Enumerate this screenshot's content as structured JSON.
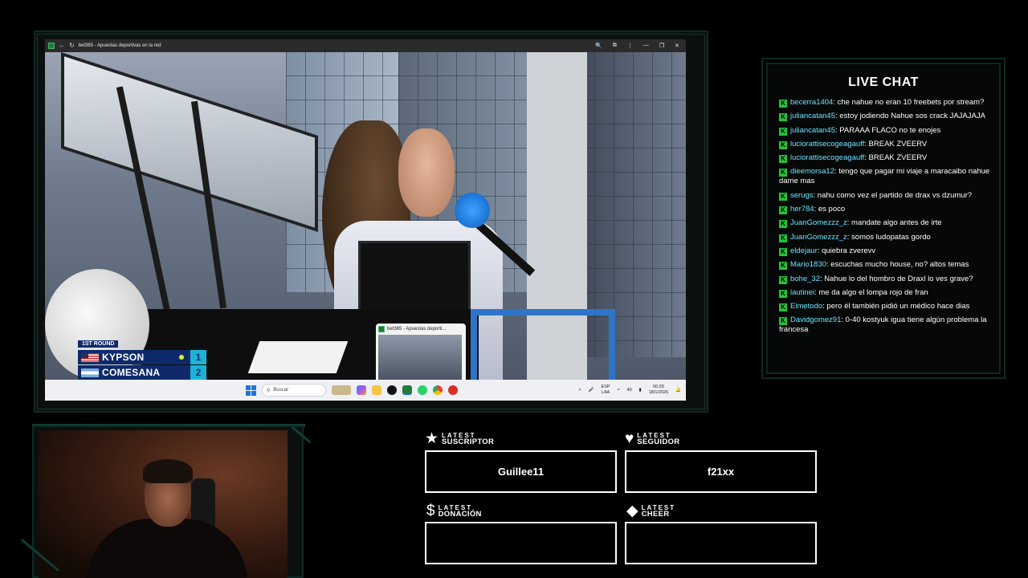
{
  "browser": {
    "tab_title": "bet365 - Apuestas deportivas en la red"
  },
  "scoreboard": {
    "round": "1ST ROUND",
    "players": [
      {
        "name": "KYPSON",
        "score": "1",
        "flag": "US",
        "serving": true
      },
      {
        "name": "COMESANA",
        "score": "2",
        "flag": "AR",
        "serving": false
      }
    ]
  },
  "thumbnail": {
    "title": "bet365 - Apuestas deporti..."
  },
  "taskbar": {
    "search_placeholder": "Buscar",
    "lang_top": "ESP",
    "lang_bottom": "LAA",
    "volume": "40",
    "time": "00:29",
    "date": "18/1/2026"
  },
  "chat": {
    "title": "LIVE CHAT",
    "messages": [
      {
        "user": "becerra1404",
        "text": "che nahue no eran 10 freebets por stream?"
      },
      {
        "user": "juliancatan45",
        "text": "estoy jodiendo Nahue sos crack JAJAJAJA"
      },
      {
        "user": "juliancatan45",
        "text": "PARAAA FLACO no te enojes"
      },
      {
        "user": "luciorattisecogeagauff",
        "text": "BREAK ZVEERV"
      },
      {
        "user": "luciorattisecogeagauff",
        "text": "BREAK ZVEERV"
      },
      {
        "user": "dieemorsa12",
        "text": "tengo que pagar mi viaje a maracaibo nahue dame mas"
      },
      {
        "user": "serugs",
        "text": "nahu como vez el partido de drax vs dzumur?"
      },
      {
        "user": "her784",
        "text": "es poco"
      },
      {
        "user": "JuanGomezzz_z",
        "text": "mandate algo antes de irte"
      },
      {
        "user": "JuanGomezzz_z",
        "text": "somos ludopatas gordo"
      },
      {
        "user": "eldejaur",
        "text": "quiebra zverevv"
      },
      {
        "user": "Mario1830",
        "text": "escuchas mucho house, no? altos temas"
      },
      {
        "user": "bohe_32",
        "text": "Nahue lo del hombro de Draxl lo ves grave?"
      },
      {
        "user": "lautinei",
        "text": "me da algo el lompa rojo de fran"
      },
      {
        "user": "Elmetodo",
        "text": "pero él también pidió un médico hace dias"
      },
      {
        "user": "Davidgomez91",
        "text": "0-40 kostyuk igua tiene algún problema la francesa"
      }
    ]
  },
  "widgets": {
    "suscriptor": {
      "small": "LATEST",
      "big": "SUSCRIPTOR",
      "value": "Guillee11",
      "icon": "star-icon"
    },
    "seguidor": {
      "small": "LATEST",
      "big": "SEGUIDOR",
      "value": "f21xx",
      "icon": "heart-icon"
    },
    "donacion": {
      "small": "LATEST",
      "big": "DONACIÓN",
      "value": "",
      "icon": "dollar-icon"
    },
    "cheer": {
      "small": "LATEST",
      "big": "CHEER",
      "value": "",
      "icon": "diamond-icon"
    }
  },
  "colors": {
    "chat_username": "#6fe0ff",
    "chat_badge": "#28c13a",
    "frame_accent": "#0d2a23",
    "score_bg": "#0f2a6b",
    "score_box": "#1ab3d6"
  }
}
